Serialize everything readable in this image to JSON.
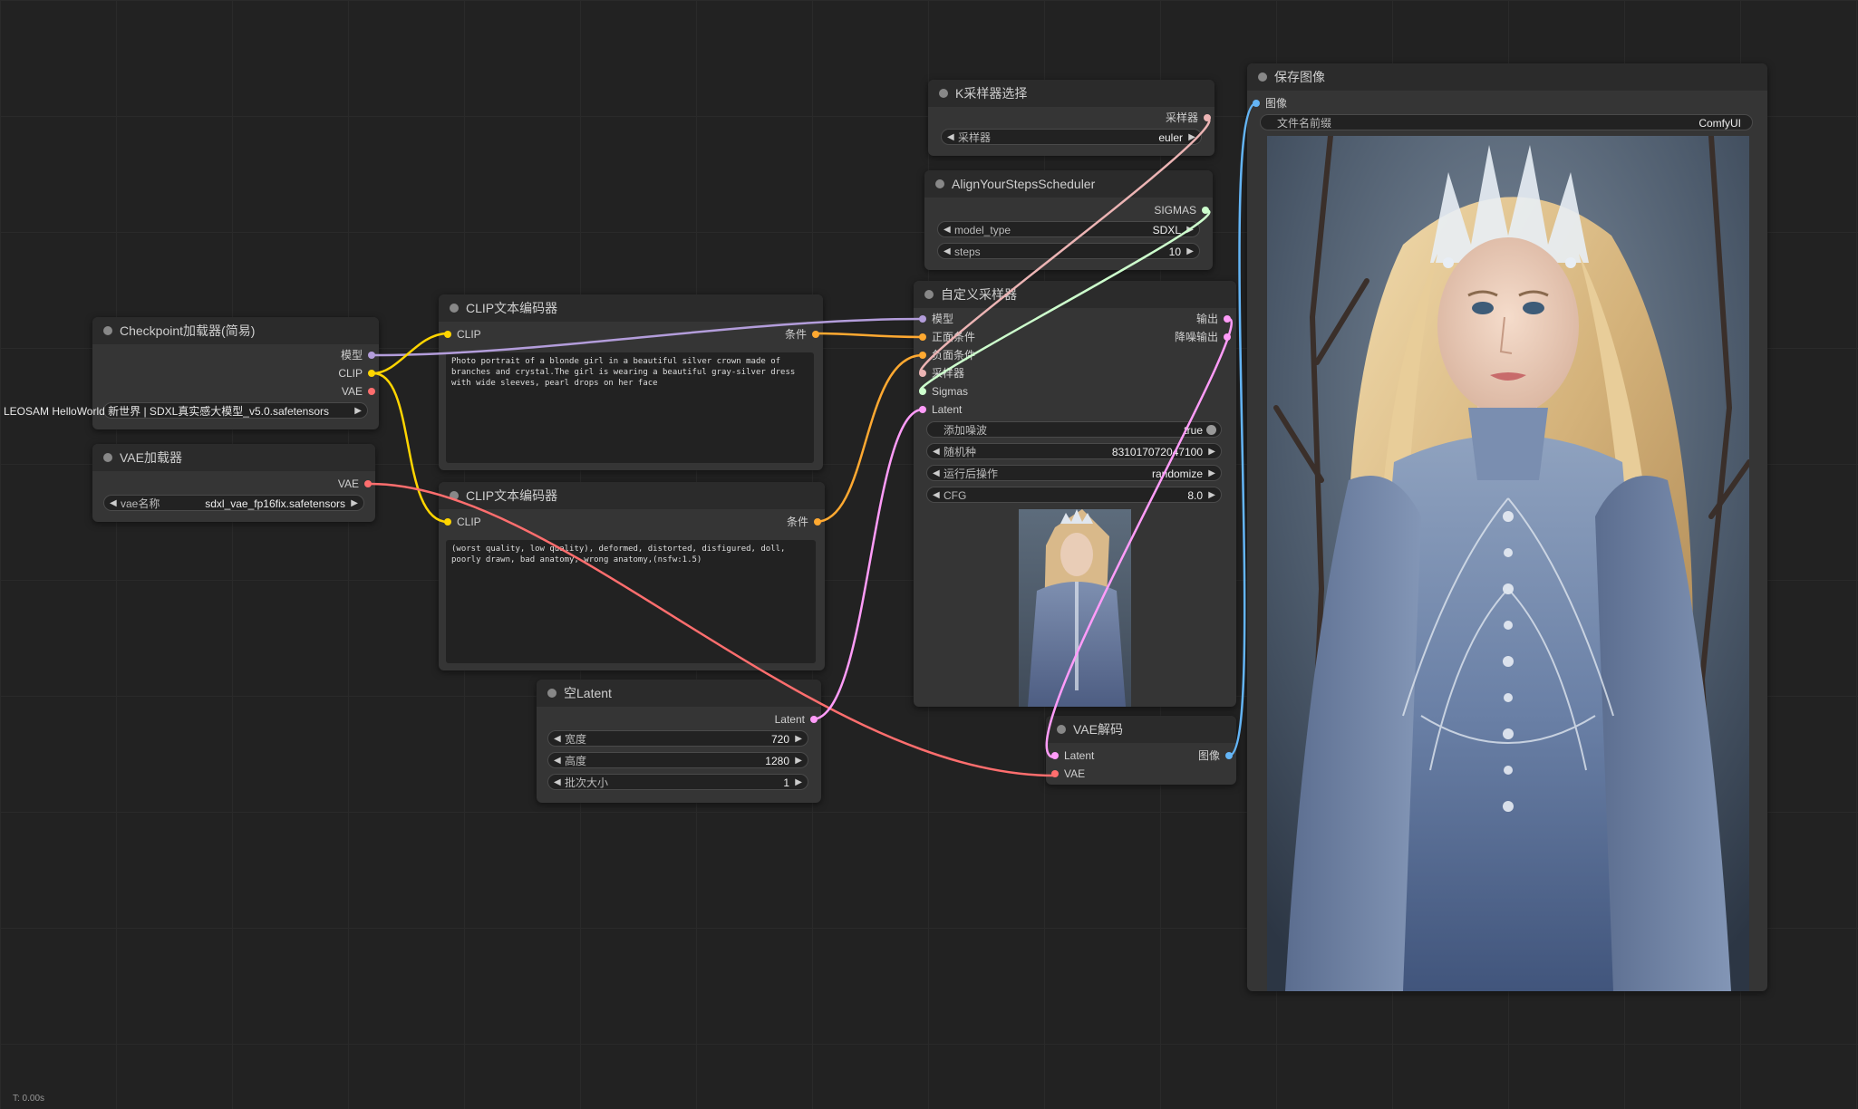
{
  "status_time": "T: 0.00s",
  "overlap_label": "LEOSAM HelloWorld 新世界 | SDXL真实感大模型_v5.0.safetensors",
  "colors": {
    "model": "#b39ddb",
    "clip": "#ffd500",
    "vae": "#ff6e6e",
    "conditioning": "#ffa931",
    "latent": "#ff9cf9",
    "image": "#64b5f6",
    "sigmas": "#cdffcd",
    "sampler": "#ecb4b4"
  },
  "nodes": {
    "checkpoint": {
      "title": "Checkpoint加载器(简易)",
      "outputs": [
        "模型",
        "CLIP",
        "VAE"
      ],
      "widget_value": "LEOSAM HelloWorld 新世界 | SDXL真实感大模型_v5.0.safetensors"
    },
    "vae_loader": {
      "title": "VAE加载器",
      "output": "VAE",
      "widget_label": "vae名称",
      "widget_value": "sdxl_vae_fp16fix.safetensors"
    },
    "clip_pos": {
      "title": "CLIP文本编码器",
      "input": "CLIP",
      "output": "条件",
      "text": "Photo portrait of a blonde girl in a beautiful silver crown made of branches and crystal.The girl is wearing a beautiful gray-silver dress with wide sleeves, pearl drops on her face"
    },
    "clip_neg": {
      "title": "CLIP文本编码器",
      "input": "CLIP",
      "output": "条件",
      "text": "(worst quality, low quality), deformed, distorted, disfigured, doll, poorly drawn, bad anatomy, wrong anatomy,(nsfw:1.5)"
    },
    "empty_latent": {
      "title": "空Latent",
      "output": "Latent",
      "widgets": [
        {
          "label": "宽度",
          "value": "720"
        },
        {
          "label": "高度",
          "value": "1280"
        },
        {
          "label": "批次大小",
          "value": "1"
        }
      ]
    },
    "ksampler_select": {
      "title": "K采样器选择",
      "output": "采样器",
      "widget_label": "采样器",
      "widget_value": "euler"
    },
    "ays": {
      "title": "AlignYourStepsScheduler",
      "output": "SIGMAS",
      "widgets": [
        {
          "label": "model_type",
          "value": "SDXL"
        },
        {
          "label": "steps",
          "value": "10"
        }
      ]
    },
    "custom_sampler": {
      "title": "自定义采样器",
      "inputs": [
        "模型",
        "正面条件",
        "负面条件",
        "采样器",
        "Sigmas",
        "Latent"
      ],
      "outputs": [
        "输出",
        "降噪输出"
      ],
      "toggle": {
        "label": "添加噪波",
        "value": "true"
      },
      "widgets": [
        {
          "label": "随机种",
          "value": "831017072047100"
        },
        {
          "label": "运行后操作",
          "value": "randomize"
        },
        {
          "label": "CFG",
          "value": "8.0"
        }
      ]
    },
    "vae_decode": {
      "title": "VAE解码",
      "inputs": [
        "Latent",
        "VAE"
      ],
      "output": "图像"
    },
    "save_image": {
      "title": "保存图像",
      "input": "图像",
      "widget_label": "文件名前缀",
      "widget_value": "ComfyUI"
    }
  }
}
